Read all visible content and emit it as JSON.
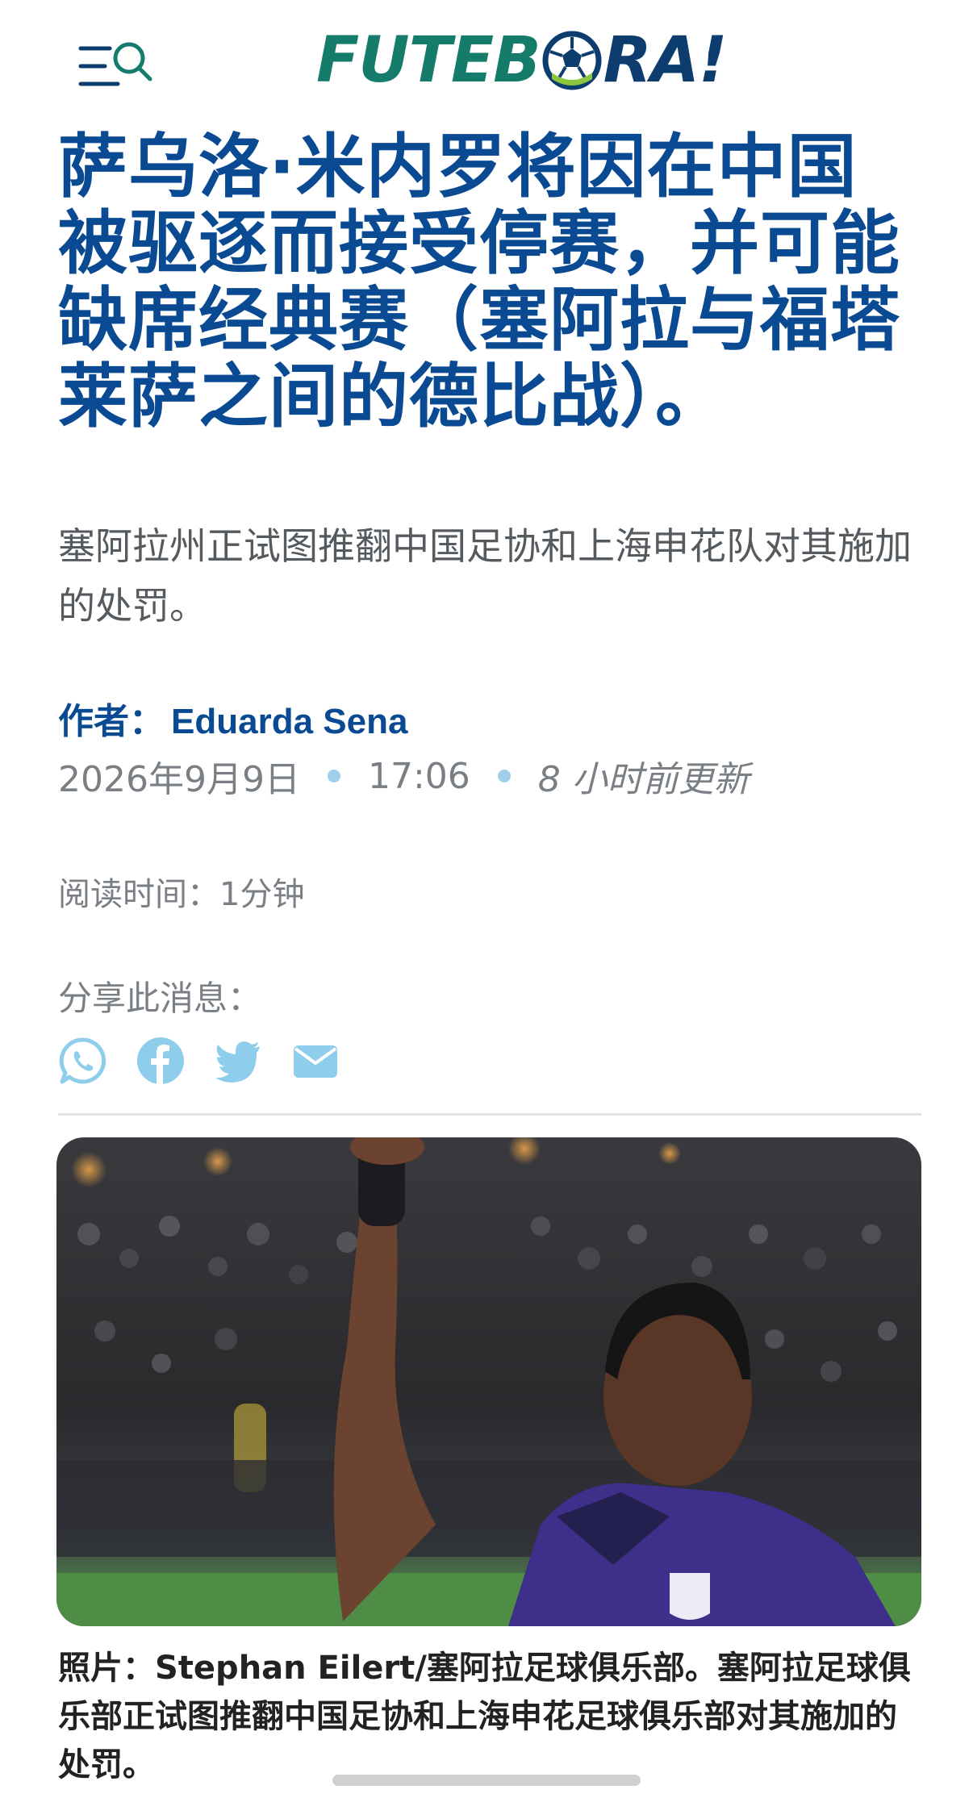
{
  "header": {
    "logo_left": "FUTEB",
    "logo_right": "RA!",
    "menu_icon": "menu-search-icon"
  },
  "article": {
    "title": "萨乌洛·米内罗将因在中国被驱逐而接受停赛，并可能缺席经典赛（塞阿拉与福塔莱萨之间的德比战）。",
    "subtitle": "塞阿拉州正试图推翻中国足协和上海申花队对其施加的处罚。",
    "author_label": "作者：",
    "author_name": "Eduarda Sena",
    "date": "2026年9月9日",
    "time": "17:06",
    "updated": "8 小时前更新",
    "read_time": "阅读时间：1分钟",
    "share_label": "分享此消息：",
    "share_icons": [
      "whatsapp-icon",
      "facebook-icon",
      "twitter-icon",
      "email-icon"
    ],
    "caption": "照片：Stephan Eilert/塞阿拉足球俱乐部。塞阿拉足球俱乐部正试图推翻中国足协和上海申花足球俱乐部对其施加的处罚。"
  },
  "colors": {
    "title": "#0a4a93",
    "logo_green": "#157c6c",
    "logo_navy": "#0d3d6e",
    "share_icon": "#8fcdec",
    "meta_dot": "#9ed0ec"
  }
}
